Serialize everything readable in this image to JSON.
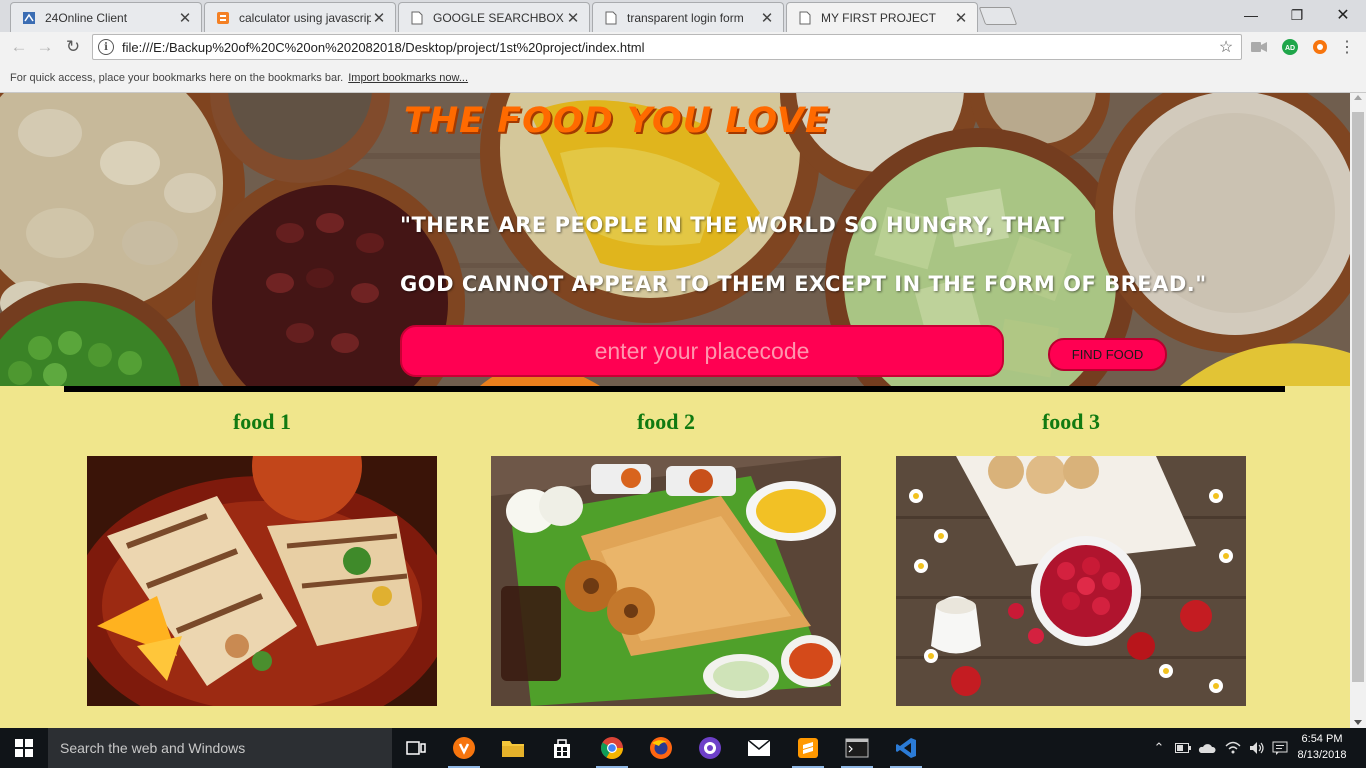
{
  "browser": {
    "tabs": [
      {
        "title": "24Online Client",
        "active": false
      },
      {
        "title": "calculator using javascrip",
        "active": false
      },
      {
        "title": "GOOGLE SEARCHBOX",
        "active": false
      },
      {
        "title": "transparent login form",
        "active": false
      },
      {
        "title": "MY FIRST PROJECT",
        "active": true
      }
    ],
    "url": "file:///E:/Backup%20of%20C%20on%202082018/Desktop/project/1st%20project/index.html",
    "extension_badge": "AD",
    "bookmarks_hint": "For quick access, place your bookmarks here on the bookmarks bar.",
    "bookmarks_link": "Import bookmarks now..."
  },
  "page": {
    "title": "THE FOOD YOU LOVE",
    "quote_line1": "\"THERE ARE PEOPLE IN THE WORLD SO HUNGRY, THAT",
    "quote_line2": "GOD CANNOT APPEAR TO THEM EXCEPT IN THE FORM OF BREAD.\"",
    "search_placeholder": "enter your placecode",
    "find_button": "FIND FOOD",
    "foods": [
      {
        "label": "food 1"
      },
      {
        "label": "food 2"
      },
      {
        "label": "food 3"
      }
    ]
  },
  "taskbar": {
    "search_placeholder": "Search the web and Windows",
    "time": "6:54 PM",
    "date": "8/13/2018"
  },
  "colors": {
    "page_background": "#f0e68c",
    "title": "#ff6a00",
    "search_fill": "#ff0052",
    "food_label": "#117a11"
  }
}
